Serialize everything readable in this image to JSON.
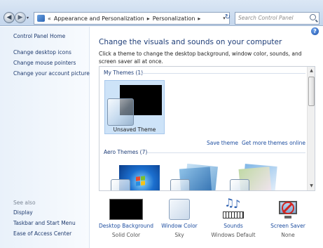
{
  "address": {
    "breadcrumb": [
      "Appearance and Personalization",
      "Personalization"
    ],
    "separator": "▸",
    "overflow": "«"
  },
  "search": {
    "placeholder": "Search Control Panel"
  },
  "sidebar": {
    "items": [
      {
        "label": "Control Panel Home"
      },
      {
        "label": "Change desktop icons"
      },
      {
        "label": "Change mouse pointers"
      },
      {
        "label": "Change your account picture"
      }
    ],
    "see_also_heading": "See also",
    "see_also": [
      {
        "label": "Display"
      },
      {
        "label": "Taskbar and Start Menu"
      },
      {
        "label": "Ease of Access Center"
      }
    ]
  },
  "main": {
    "heading": "Change the visuals and sounds on your computer",
    "description": "Click a theme to change the desktop background, window color, sounds, and screen saver all at once.",
    "my_themes": {
      "title": "My Themes (1)",
      "themes": [
        {
          "name": "Unsaved Theme",
          "selected": true
        }
      ]
    },
    "save_theme": "Save theme",
    "get_more": "Get more themes online",
    "aero_themes": {
      "title": "Aero Themes (7)"
    }
  },
  "options": [
    {
      "label": "Desktop Background",
      "value": "Solid Color",
      "icon": "desktop-background-icon"
    },
    {
      "label": "Window Color",
      "value": "Sky",
      "icon": "window-color-icon"
    },
    {
      "label": "Sounds",
      "value": "Windows Default",
      "icon": "sounds-icon"
    },
    {
      "label": "Screen Saver",
      "value": "None",
      "icon": "screen-saver-icon"
    }
  ],
  "colors": {
    "link": "#1e4ea0",
    "heading": "#1f3e78",
    "selected_tile": "#cde3f8"
  }
}
